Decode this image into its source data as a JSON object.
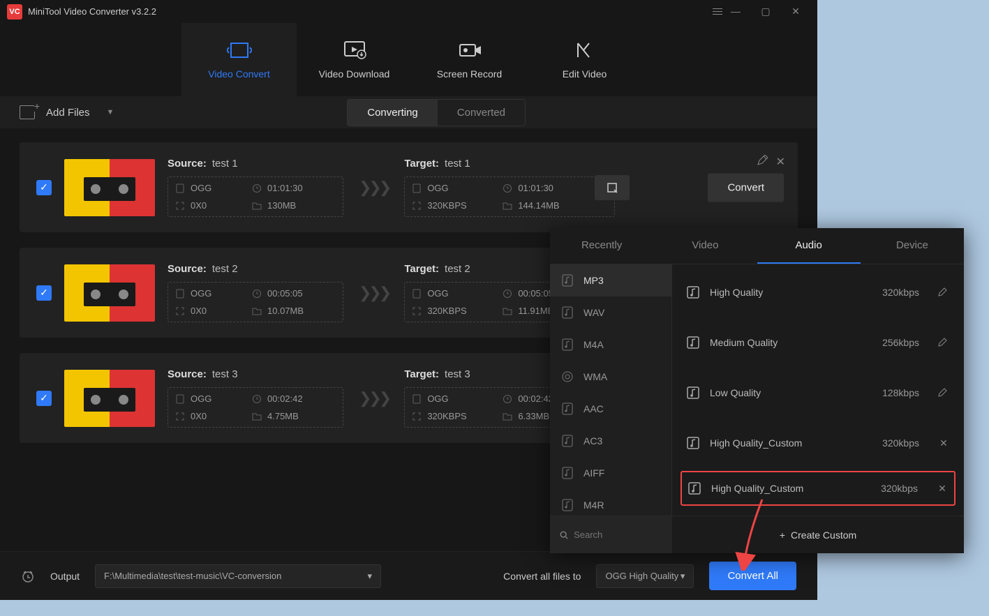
{
  "titlebar": {
    "app_name": "MiniTool Video Converter v3.2.2"
  },
  "topTabs": {
    "convert": "Video Convert",
    "download": "Video Download",
    "record": "Screen Record",
    "edit": "Edit Video"
  },
  "toolbar": {
    "add_files": "Add Files",
    "converting": "Converting",
    "converted": "Converted"
  },
  "labels": {
    "source": "Source:",
    "target": "Target:"
  },
  "items": [
    {
      "source_name": "test 1",
      "target_name": "test 1",
      "s_fmt": "OGG",
      "s_dur": "01:01:30",
      "s_res": "0X0",
      "s_size": "130MB",
      "t_fmt": "OGG",
      "t_dur": "01:01:30",
      "t_br": "320KBPS",
      "t_size": "144.14MB",
      "btn": "Convert"
    },
    {
      "source_name": "test 2",
      "target_name": "test 2",
      "s_fmt": "OGG",
      "s_dur": "00:05:05",
      "s_res": "0X0",
      "s_size": "10.07MB",
      "t_fmt": "OGG",
      "t_dur": "00:05:05",
      "t_br": "320KBPS",
      "t_size": "11.91MB"
    },
    {
      "source_name": "test 3",
      "target_name": "test 3",
      "s_fmt": "OGG",
      "s_dur": "00:02:42",
      "s_res": "0X0",
      "s_size": "4.75MB",
      "t_fmt": "OGG",
      "t_dur": "00:02:42",
      "t_br": "320KBPS",
      "t_size": "6.33MB"
    }
  ],
  "bottom": {
    "output_label": "Output",
    "output_path": "F:\\Multimedia\\test\\test-music\\VC-conversion",
    "convert_all_to": "Convert all files to",
    "all_format": "OGG High Quality",
    "convert_all": "Convert All"
  },
  "popup": {
    "tabs": {
      "recently": "Recently",
      "video": "Video",
      "audio": "Audio",
      "device": "Device"
    },
    "formats": [
      "MP3",
      "WAV",
      "M4A",
      "WMA",
      "AAC",
      "AC3",
      "AIFF",
      "M4R"
    ],
    "qualities": [
      {
        "name": "High Quality",
        "rate": "320kbps",
        "action": "edit"
      },
      {
        "name": "Medium Quality",
        "rate": "256kbps",
        "action": "edit"
      },
      {
        "name": "Low Quality",
        "rate": "128kbps",
        "action": "edit"
      },
      {
        "name": "High Quality_Custom",
        "rate": "320kbps",
        "action": "close"
      },
      {
        "name": "High Quality_Custom",
        "rate": "320kbps",
        "action": "close",
        "highlight": true
      }
    ],
    "search_ph": "Search",
    "create_custom": "Create Custom"
  }
}
